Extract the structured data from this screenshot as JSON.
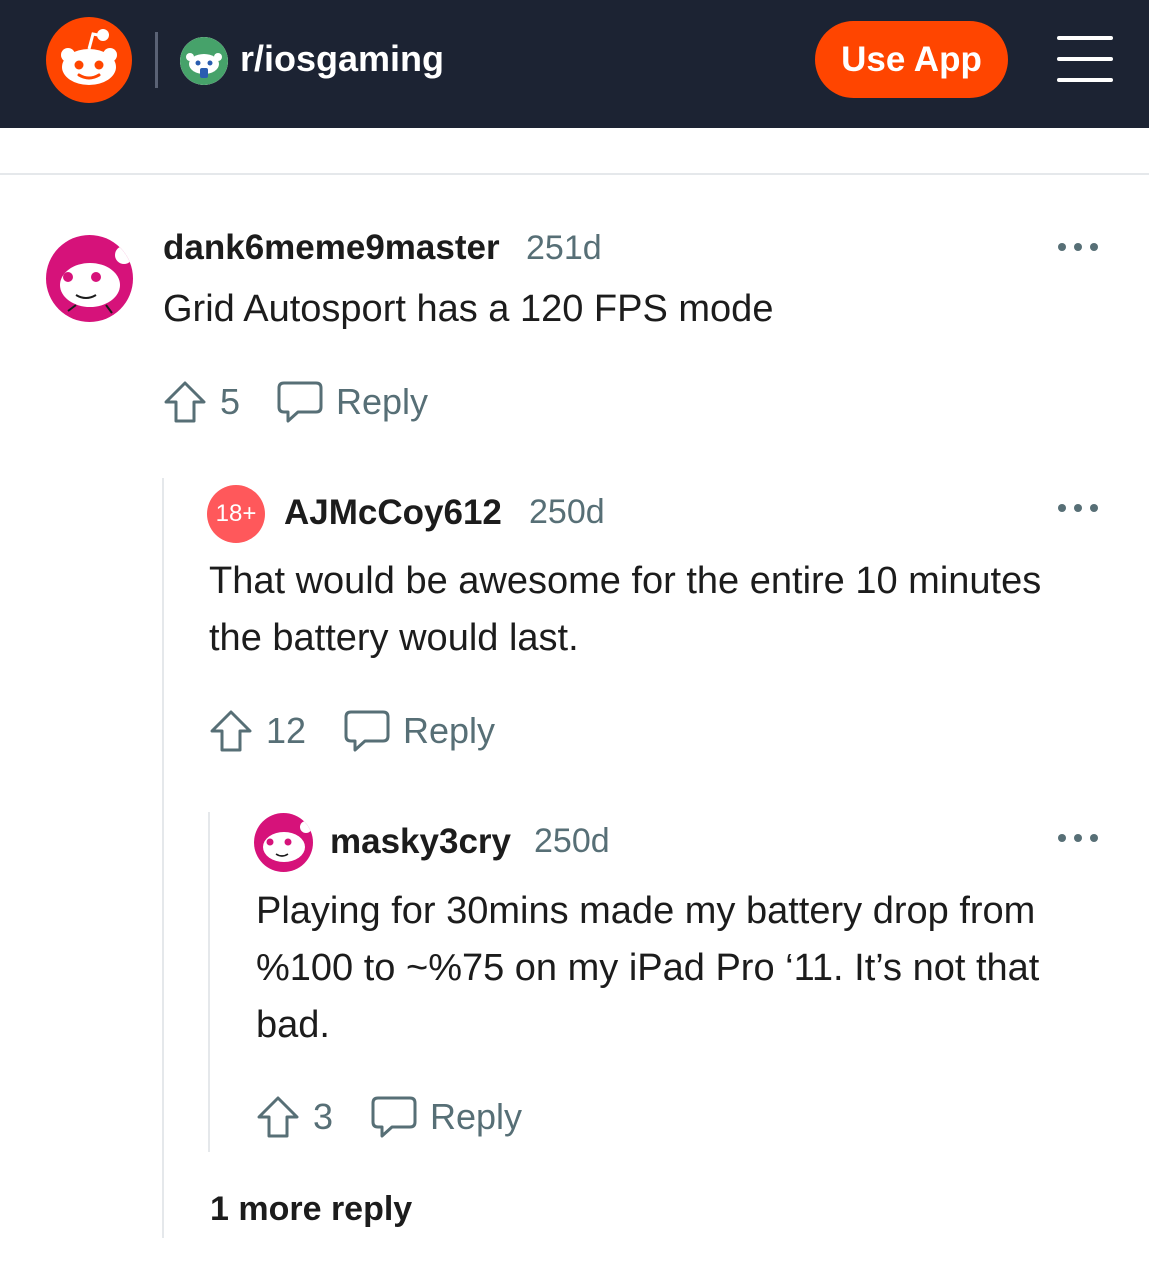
{
  "header": {
    "subreddit": "r/iosgaming",
    "use_app_label": "Use App",
    "brand_color": "#ff4500",
    "bar_color": "#1c2333"
  },
  "comments": [
    {
      "username": "dank6meme9master",
      "age": "251d",
      "text": "Grid Autosport has a 120 FPS mode",
      "votes": "5",
      "reply_label": "Reply",
      "avatar_color": "#d6127a"
    },
    {
      "username": "AJMcCoy612",
      "badge": "18+",
      "age": "250d",
      "text": "That would be awesome for the entire 10 minutes the battery would last.",
      "votes": "12",
      "reply_label": "Reply",
      "badge_color": "#ff585b"
    },
    {
      "username": "masky3cry",
      "age": "250d",
      "text": "Playing for 30mins made my battery drop from %100 to ~%75 on my iPad Pro ‘11. It’s not that bad.",
      "votes": "3",
      "reply_label": "Reply",
      "avatar_color": "#d6127a"
    }
  ],
  "more_replies": "1 more reply",
  "icons": [
    "reddit-logo-icon",
    "subreddit-avatar-icon",
    "hamburger-menu-icon",
    "more-options-icon",
    "upvote-icon",
    "reply-bubble-icon"
  ]
}
